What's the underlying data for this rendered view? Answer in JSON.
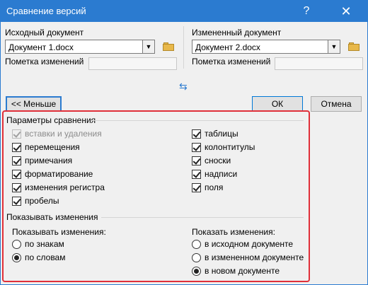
{
  "window": {
    "title": "Сравнение версий",
    "help_glyph": "?",
    "close_glyph": "✕"
  },
  "original": {
    "label": "Исходный документ",
    "value": "Документ 1.docx",
    "note_label": "Пометка изменений"
  },
  "revised": {
    "label": "Измененный документ",
    "value": "Документ 2.docx",
    "note_label": "Пометка изменений"
  },
  "swap_glyph": "⇆",
  "buttons": {
    "less": "<< Меньше",
    "ok": "ОК",
    "cancel": "Отмена"
  },
  "compare_settings": {
    "title": "Параметры сравнения",
    "left": [
      {
        "label": "вставки и удаления",
        "checked": true,
        "disabled": true
      },
      {
        "label": "перемещения",
        "checked": true,
        "disabled": false
      },
      {
        "label": "примечания",
        "checked": true,
        "disabled": false
      },
      {
        "label": "форматирование",
        "checked": true,
        "disabled": false
      },
      {
        "label": "изменения регистра",
        "checked": true,
        "disabled": false
      },
      {
        "label": "пробелы",
        "checked": true,
        "disabled": false
      }
    ],
    "right": [
      {
        "label": "таблицы",
        "checked": true
      },
      {
        "label": "колонтитулы",
        "checked": true
      },
      {
        "label": "сноски",
        "checked": true
      },
      {
        "label": "надписи",
        "checked": true
      },
      {
        "label": "поля",
        "checked": true
      }
    ]
  },
  "show_changes": {
    "title": "Показывать изменения",
    "level": {
      "label": "Показывать изменения:",
      "options": [
        {
          "label": "по знакам",
          "selected": false
        },
        {
          "label": "по словам",
          "selected": true
        }
      ]
    },
    "location": {
      "label": "Показать изменения:",
      "options": [
        {
          "label": "в исходном документе",
          "selected": false
        },
        {
          "label": "в измененном документе",
          "selected": false
        },
        {
          "label": "в новом документе",
          "selected": true
        }
      ]
    }
  },
  "colors": {
    "accent": "#2b7bd0",
    "highlight": "#e0303a"
  }
}
